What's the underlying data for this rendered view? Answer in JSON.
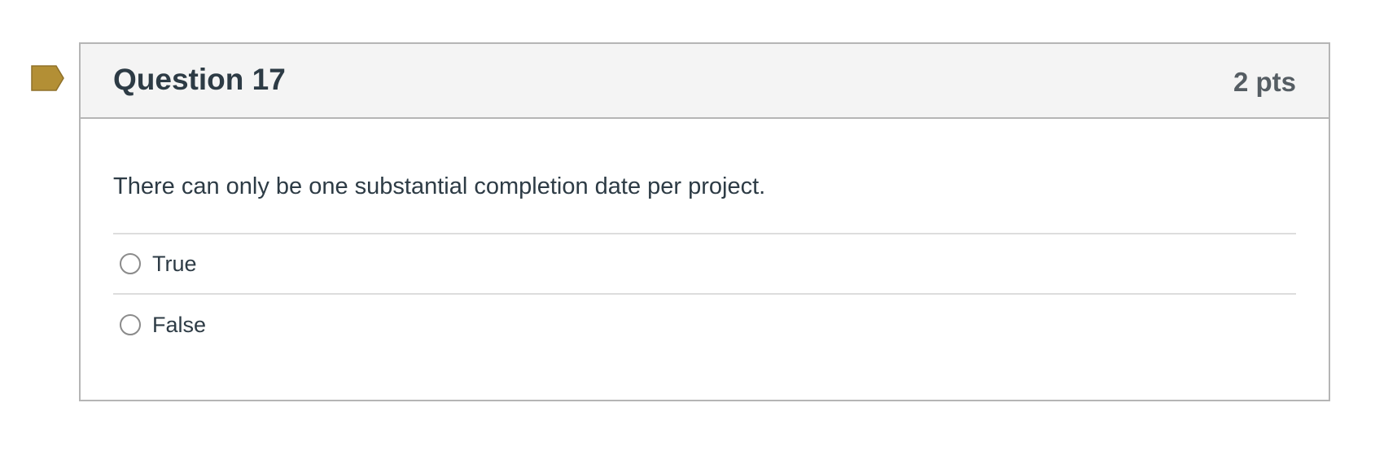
{
  "flag": {
    "icon": "bookmark-flag-icon",
    "color": "#b38f35"
  },
  "question": {
    "title": "Question 17",
    "points": "2 pts",
    "text": "There can only be one substantial completion date per project.",
    "answers": [
      {
        "label": "True",
        "selected": false
      },
      {
        "label": "False",
        "selected": false
      }
    ]
  }
}
